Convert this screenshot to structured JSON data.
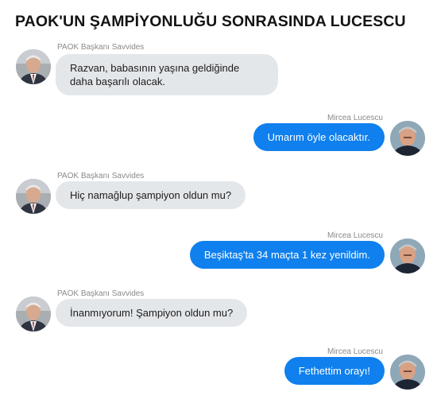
{
  "title": "PAOK'UN ŞAMPİYONLUĞU SONRASINDA LUCESCU",
  "messages": [
    {
      "side": "in",
      "sender": "PAOK Başkanı Savvides",
      "text": "Razvan, babasının yaşına geldiğinde daha başarılı olacak.",
      "avatar": "savvides-avatar"
    },
    {
      "side": "out",
      "sender": "Mircea Lucescu",
      "text": "Umarım öyle olacaktır.",
      "avatar": "lucescu-avatar"
    },
    {
      "side": "in",
      "sender": "PAOK Başkanı Savvides",
      "text": "Hiç namağlup şampiyon oldun mu?",
      "avatar": "savvides-avatar"
    },
    {
      "side": "out",
      "sender": "Mircea Lucescu",
      "text": "Beşiktaş'ta 34 maçta 1 kez yenildim.",
      "avatar": "lucescu-avatar"
    },
    {
      "side": "in",
      "sender": "PAOK Başkanı Savvides",
      "text": "İnanmıyorum! Şampiyon oldun mu?",
      "avatar": "savvides-avatar"
    },
    {
      "side": "out",
      "sender": "Mircea Lucescu",
      "text": "Fethettim orayı!",
      "avatar": "lucescu-avatar"
    }
  ],
  "colors": {
    "incoming_bubble": "#e4e7ea",
    "outgoing_bubble": "#0f80ee",
    "sender_label": "#8a8a8a"
  }
}
